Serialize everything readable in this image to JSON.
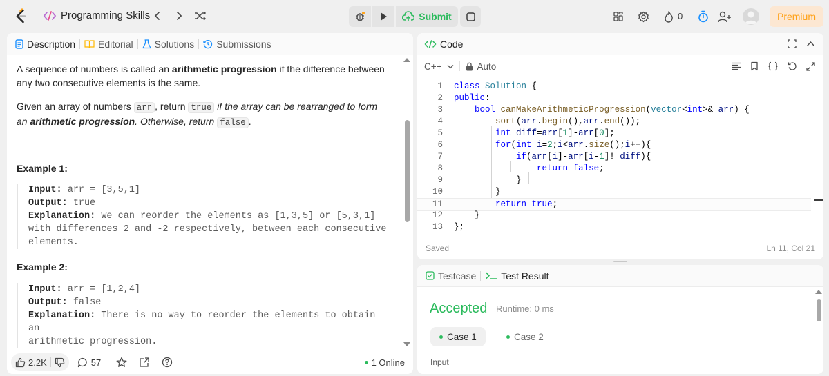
{
  "header": {
    "list_title": "Programming Skills",
    "submit_label": "Submit",
    "streak_count": "0",
    "premium_label": "Premium"
  },
  "left": {
    "tabs": [
      {
        "label": "Description"
      },
      {
        "label": "Editorial"
      },
      {
        "label": "Solutions"
      },
      {
        "label": "Submissions"
      }
    ],
    "p1_a": "A sequence of numbers is called an ",
    "p1_b": "arithmetic progression",
    "p1_c": " if the difference between any two consecutive elements is the same.",
    "p2_a": "Given an array of numbers ",
    "p2_code1": "arr",
    "p2_b": ", return ",
    "p2_code2": "true",
    "p2_c": " if the array can be rearranged to form an ",
    "p2_d": "arithmetic progression",
    "p2_e": ". Otherwise, return ",
    "p2_code3": "false",
    "p2_f": ".",
    "ex1_title": "Example 1:",
    "ex1": {
      "input_label": "Input:",
      "input": "arr = [3,5,1]",
      "output_label": "Output:",
      "output": "true",
      "expl_label": "Explanation:",
      "expl_1": "We can reorder the elements as [1,3,5] or [5,3,1]",
      "expl_2": "with differences 2 and -2 respectively, between each consecutive",
      "expl_3": "elements."
    },
    "ex2_title": "Example 2:",
    "ex2": {
      "input_label": "Input:",
      "input": "arr = [1,2,4]",
      "output_label": "Output:",
      "output": "false",
      "expl_label": "Explanation:",
      "expl_1": "There is no way to reorder the elements to obtain an",
      "expl_2": "arithmetic progression."
    },
    "footer": {
      "likes": "2.2K",
      "comments": "57",
      "online": "1 Online"
    }
  },
  "code": {
    "title": "Code",
    "language": "C++",
    "mode": "Auto",
    "saved": "Saved",
    "position": "Ln 11, Col 21",
    "line_numbers": [
      "1",
      "2",
      "3",
      "4",
      "5",
      "6",
      "7",
      "8",
      "9",
      "10",
      "11",
      "12",
      "13"
    ]
  },
  "result": {
    "tab_testcase": "Testcase",
    "tab_result": "Test Result",
    "status": "Accepted",
    "runtime": "Runtime: 0 ms",
    "case1": "Case 1",
    "case2": "Case 2",
    "input_label": "Input"
  },
  "colors": {
    "accent_green": "#2cbb5d",
    "premium_orange": "#ffa116"
  }
}
